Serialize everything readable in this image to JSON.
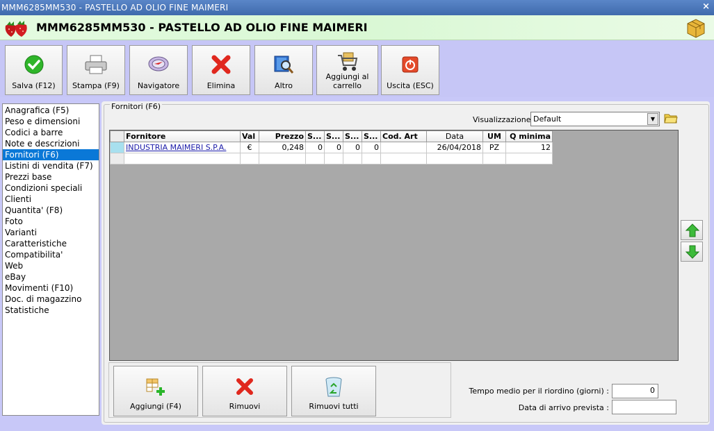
{
  "window": {
    "title": "MMM6285MM530 - PASTELLO AD OLIO FINE MAIMERI",
    "close_glyph": "×"
  },
  "header": {
    "title": "MMM6285MM530 - PASTELLO AD OLIO FINE MAIMERI",
    "logo_icon": "strawberry-icon",
    "right_icon": "boxes-icon"
  },
  "toolbar": {
    "save": "Salva (F12)",
    "print": "Stampa (F9)",
    "navigator": "Navigatore",
    "delete": "Elimina",
    "other": "Altro",
    "cart_line1": "Aggiungi al",
    "cart_line2": "carrello",
    "exit": "Uscita (ESC)"
  },
  "sidebar": {
    "items": [
      "Anagrafica (F5)",
      "Peso e dimensioni",
      "Codici a barre",
      "Note e descrizioni",
      "Fornitori (F6)",
      "Listini di vendita (F7)",
      "Prezzi base",
      "Condizioni speciali",
      "Clienti",
      "Quantita' (F8)",
      "Foto",
      "Varianti",
      "Caratteristiche",
      "Compatibilita'",
      "Web",
      "eBay",
      "Movimenti (F10)",
      "Doc. di magazzino",
      "Statistiche"
    ],
    "selected_index": 4
  },
  "panel": {
    "legend": "Fornitori (F6)",
    "view_label": "Visualizzazione :",
    "view_value": "Default"
  },
  "grid": {
    "columns": [
      "Fornitore",
      "Val",
      "Prezzo",
      "S...",
      "S...",
      "S...",
      "S...",
      "Cod. Art",
      "Data",
      "UM",
      "Q minima"
    ],
    "rows": [
      [
        "INDUSTRIA MAIMERI S.P.A.",
        "€",
        "0,248",
        "0",
        "0",
        "0",
        "0",
        "",
        "26/04/2018",
        "PZ",
        "12"
      ]
    ]
  },
  "bottom": {
    "add": "Aggiungi (F4)",
    "remove": "Rimuovi",
    "remove_all": "Rimuovi tutti",
    "reorder_label": "Tempo medio per il riordino (giorni) :",
    "reorder_value": "0",
    "arrival_label": "Data di arrivo prevista :",
    "arrival_value": ""
  }
}
